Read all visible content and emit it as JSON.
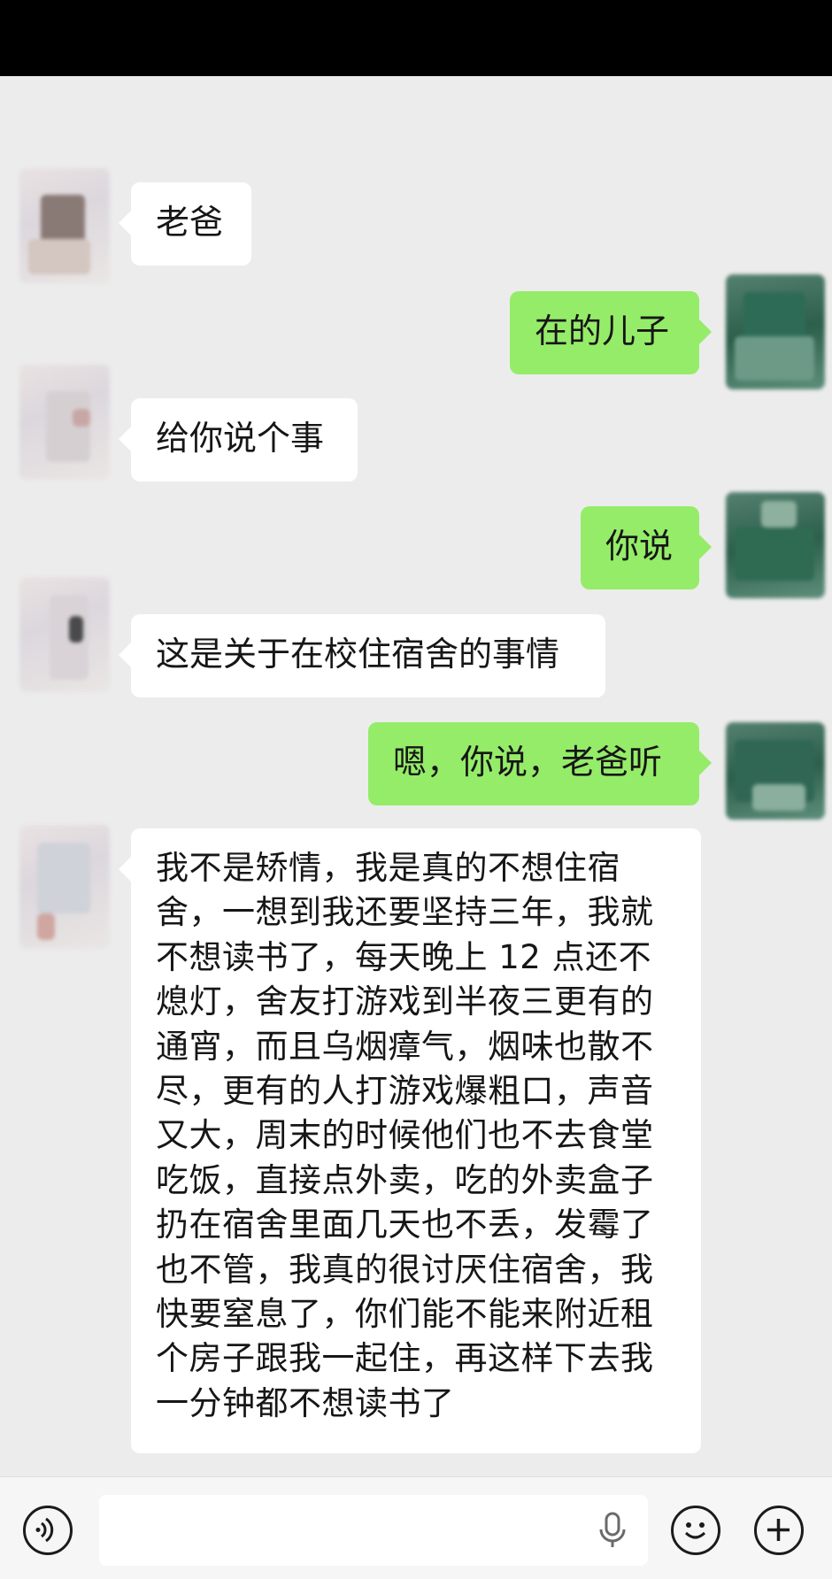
{
  "messages": [
    {
      "side": "left",
      "text": "老爸"
    },
    {
      "side": "right",
      "text": "在的儿子"
    },
    {
      "side": "left",
      "text": "给你说个事"
    },
    {
      "side": "right",
      "text": "你说"
    },
    {
      "side": "left",
      "text": "这是关于在校住宿舍的事情"
    },
    {
      "side": "right",
      "text": "嗯，你说，老爸听"
    },
    {
      "side": "left",
      "lines": [
        "我不是矫情，我是真的不想住宿",
        "舍，一想到我还要坚持三年，我就",
        "不想读书了，每天晚上 12 点还不",
        "熄灯，舍友打游戏到半夜三更有的",
        "通宵，而且乌烟瘴气，烟味也散不",
        "尽，更有的人打游戏爆粗口，声音",
        "又大，周末的时候他们也不去食堂",
        "吃饭，直接点外卖，吃的外卖盒子",
        "扔在宿舍里面几天也不丢，发霉了",
        "也不管，我真的很讨厌住宿舍，我",
        "快要窒息了，你们能不能来附近租",
        "个房子跟我一起住，再这样下去我",
        "一分钟都不想读书了"
      ]
    }
  ],
  "input_bar": {
    "voice_icon": "voice-icon",
    "mic_icon": "microphone-icon",
    "emoji_icon": "emoji-icon",
    "plus_icon": "plus-icon"
  },
  "colors": {
    "background": "#ececec",
    "bubble_mine": "#95ec69",
    "bubble_theirs": "#ffffff",
    "top_bar": "#000000"
  }
}
